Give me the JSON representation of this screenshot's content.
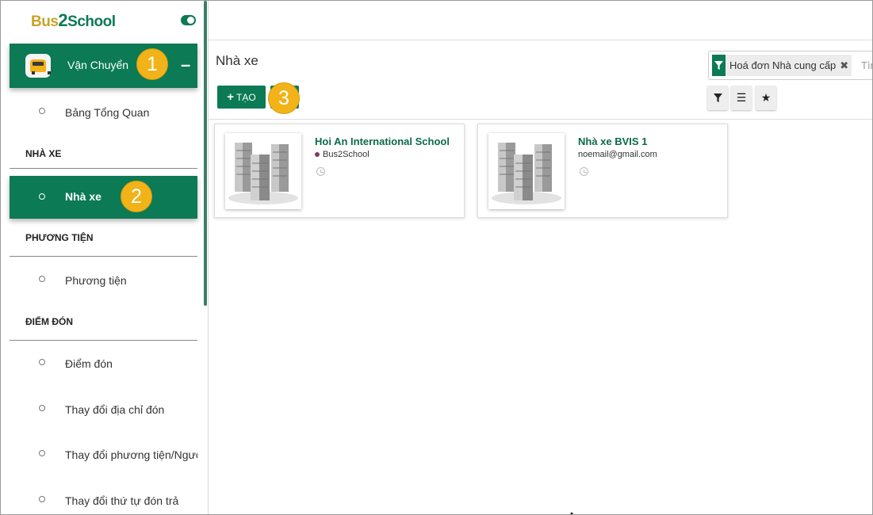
{
  "logo": {
    "part1": "Bus",
    "part2": "2",
    "part3": "School"
  },
  "app": {
    "title": "Vận Chuyển",
    "collapse_symbol": "–",
    "icon": "bus-icon"
  },
  "badges": {
    "one": "1",
    "two": "2",
    "three": "3"
  },
  "sidebar": {
    "dashboard": "Bảng Tổng Quan",
    "sections": [
      "NHÀ XE",
      "PHƯƠNG TIỆN",
      "ĐIỂM ĐÓN"
    ],
    "items": [
      "Nhà xe",
      "Phương tiện",
      "Điểm đón",
      "Thay đổi địa chỉ đón",
      "Thay đổi phương tiện/Người",
      "Thay đổi thứ tự đón trả"
    ]
  },
  "main": {
    "breadcrumb": "Nhà xe",
    "create_label": "TẠO",
    "search": {
      "facet": "Hoá đơn Nhà cung cấp",
      "placeholder": "Tìm"
    },
    "controls": [
      "filter-icon",
      "group-by-icon",
      "favorites-icon"
    ]
  },
  "cards": [
    {
      "title": "Hoi An International School",
      "subtitle": "Bus2School",
      "tag_color": "#7a3e6a"
    },
    {
      "title": "Nhà xe BVIS 1",
      "subtitle": "noemail@gmail.com"
    }
  ],
  "colors": {
    "brand": "#0b7a55",
    "badge": "#f2b319"
  }
}
